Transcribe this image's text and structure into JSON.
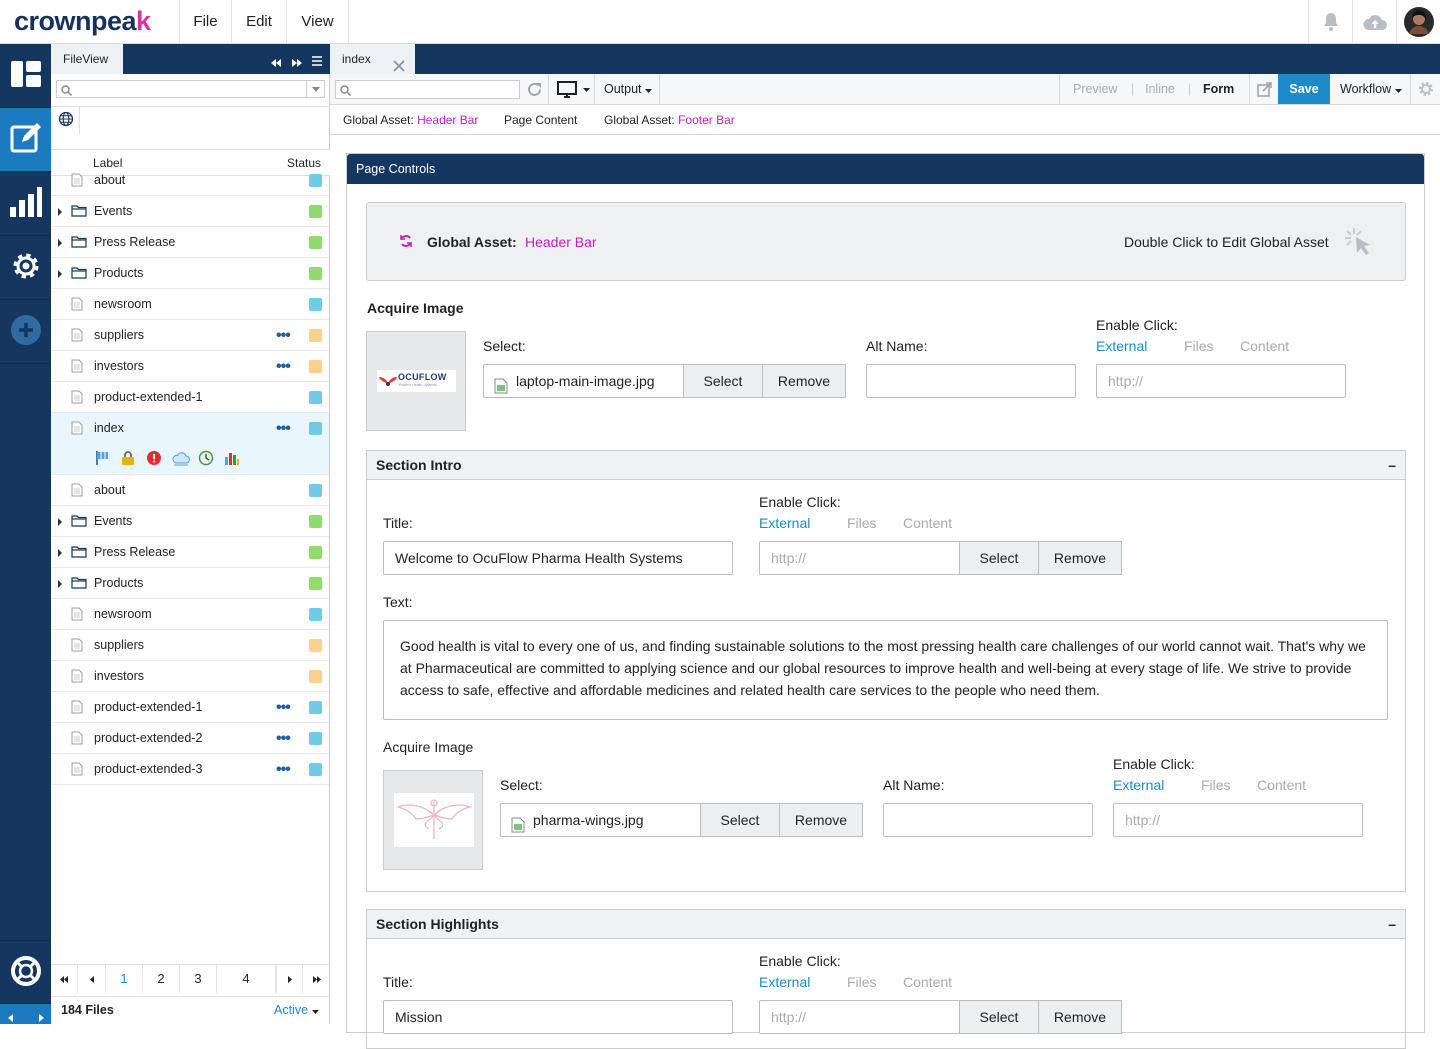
{
  "app": {
    "logo_text": "crownpea",
    "logo_k": "k",
    "menu": [
      "File",
      "Edit",
      "View"
    ]
  },
  "left_panel": {
    "tab_label": "FileView",
    "columns": {
      "label": "Label",
      "status": "Status"
    },
    "files": [
      {
        "label": "about",
        "type": "page",
        "status": "#6fcbe8",
        "dots": false
      },
      {
        "label": "Events",
        "type": "folder",
        "status": "#8fdc6c",
        "dots": false
      },
      {
        "label": "Press Release",
        "type": "folder",
        "status": "#8fdc6c",
        "dots": false
      },
      {
        "label": "Products",
        "type": "folder",
        "status": "#8fdc6c",
        "dots": false
      },
      {
        "label": "newsroom",
        "type": "page",
        "status": "#6fcbe8",
        "dots": false
      },
      {
        "label": "suppliers",
        "type": "page",
        "status": "#fcd18f",
        "dots": true
      },
      {
        "label": "investors",
        "type": "page",
        "status": "#fcd18f",
        "dots": true
      },
      {
        "label": "product-extended-1",
        "type": "page",
        "status": "#6fcbe8",
        "dots": false
      },
      {
        "label": "index",
        "type": "page",
        "status": "#6fcbe8",
        "dots": true,
        "selected": true
      },
      {
        "label": "about",
        "type": "page",
        "status": "#6fcbe8",
        "dots": false
      },
      {
        "label": "Events",
        "type": "folder",
        "status": "#8fdc6c",
        "dots": false
      },
      {
        "label": "Press Release",
        "type": "folder",
        "status": "#8fdc6c",
        "dots": false
      },
      {
        "label": "Products",
        "type": "folder",
        "status": "#8fdc6c",
        "dots": false
      },
      {
        "label": "newsroom",
        "type": "page",
        "status": "#6fcbe8",
        "dots": false
      },
      {
        "label": "suppliers",
        "type": "page",
        "status": "#fcd18f",
        "dots": false
      },
      {
        "label": "investors",
        "type": "page",
        "status": "#fcd18f",
        "dots": false
      },
      {
        "label": "product-extended-1",
        "type": "page",
        "status": "#6fcbe8",
        "dots": true
      },
      {
        "label": "product-extended-2",
        "type": "page",
        "status": "#6fcbe8",
        "dots": true
      },
      {
        "label": "product-extended-3",
        "type": "page",
        "status": "#6fcbe8",
        "dots": true
      }
    ],
    "pages": [
      "1",
      "2",
      "3",
      "4"
    ],
    "file_count": "184 Files",
    "filter": "Active"
  },
  "main": {
    "tab_label": "index",
    "toolbar": {
      "output_label": "Output",
      "preview": "Preview",
      "inline": "Inline",
      "form": "Form",
      "save": "Save",
      "workflow": "Workflow"
    },
    "crumbs": {
      "header_prefix": "Global Asset:",
      "header_link": "Header Bar",
      "page_content": "Page Content",
      "footer_prefix": "Global Asset:",
      "footer_link": "Footer Bar"
    },
    "page_controls": {
      "title": "Page Controls",
      "global_asset_label": "Global Asset:",
      "global_asset_link": "Header Bar",
      "double_click_text": "Double Click to Edit Global Asset",
      "acquire_image_title": "Acquire Image",
      "select_label": "Select:",
      "image_file": "laptop-main-image.jpg",
      "select_btn": "Select",
      "remove_btn": "Remove",
      "alt_name_label": "Alt Name:",
      "enable_click_label": "Enable Click:",
      "link_external": "External",
      "link_files": "Files",
      "link_content": "Content",
      "url_placeholder": "http://",
      "logo_brand": "OCUFLOW",
      "logo_tagline": "Pharma Health Systems"
    },
    "section_intro": {
      "title": "Section Intro",
      "collapse": "–",
      "title_label": "Title:",
      "title_value": "Welcome to OcuFlow Pharma Health Systems",
      "enable_click_label": "Enable Click:",
      "link_external": "External",
      "link_files": "Files",
      "link_content": "Content",
      "url_placeholder": "http://",
      "select_btn": "Select",
      "remove_btn": "Remove",
      "text_label": "Text:",
      "text_value": "Good health is vital to every one of us, and finding sustainable solutions to the most pressing health care challenges of our world cannot wait. That's why we at Pharmaceutical are committed to applying science and our global resources to improve health and well-being at every stage of life. We strive to provide access to safe, effective and affordable medicines and related health care services to the people who need them.",
      "acquire_image_label": "Acquire Image",
      "select_label": "Select:",
      "image_file": "pharma-wings.jpg",
      "alt_name_label": "Alt Name:"
    },
    "section_highlights": {
      "title": "Section Highlights",
      "collapse": "–",
      "title_label": "Title:",
      "title_value": "Mission",
      "enable_click_label": "Enable Click:",
      "link_external": "External",
      "link_files": "Files",
      "link_content": "Content",
      "url_placeholder": "http://",
      "select_btn": "Select",
      "remove_btn": "Remove"
    }
  },
  "colors": {
    "navy": "#15365e",
    "accent_blue": "#1c7bc0",
    "save_blue": "#1d8ac9",
    "magenta": "#c41fbd"
  }
}
